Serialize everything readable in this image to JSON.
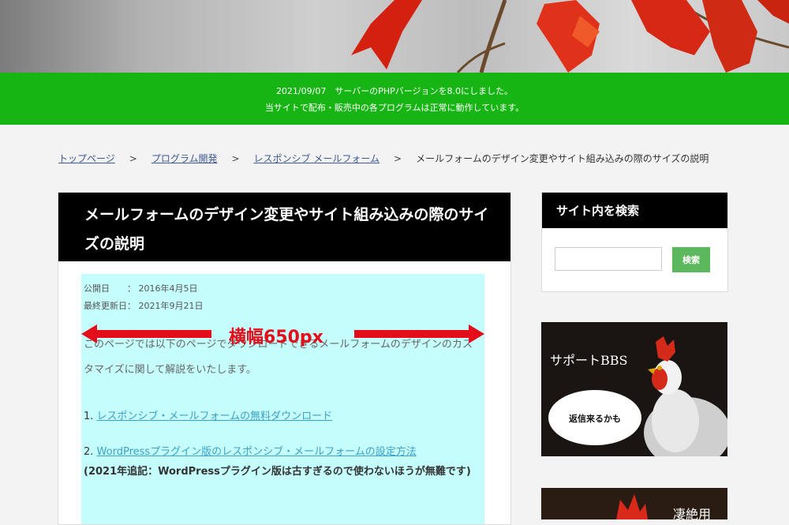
{
  "notice": {
    "line1": "2021/09/07　サーバーのPHPバージョンを8.0にしました。",
    "line2": "当サイトで配布・販売中の各プログラムは正常に動作しています。"
  },
  "breadcrumb": {
    "home": "トップページ",
    "category": "プログラム開発",
    "subcategory": "レスポンシブ メールフォーム",
    "current": "メールフォームのデザイン変更やサイト組み込みの際のサイズの説明",
    "separator": ">"
  },
  "article": {
    "title": "メールフォームのデザイン変更やサイト組み込みの際のサイズの説明",
    "published": "公開日　　：  2016年4月5日",
    "updated": "最終更新日：  2021年9月21日",
    "width_annotation": "横幅650px",
    "intro": "このページでは以下のページでダウンロードできるメールフォームのデザインのカスタマイズに関して解説をいたします。",
    "links": [
      {
        "number": "1.",
        "text": "レスポンシブ・メールフォームの無料ダウンロード"
      },
      {
        "number": "2.",
        "text": "WordPressプラグイン版のレスポンシブ・メールフォームの設定方法"
      }
    ],
    "note": "(2021年追記：WordPressプラグイン版は古すぎるので使わないほうが無難です)"
  },
  "sidebar": {
    "search_title": "サイト内を検索",
    "search_value": "",
    "search_button": "検索",
    "bbs_title": "サポートBBS",
    "bbs_bubble": "返信来るかも",
    "banner2_title": "凄絶用"
  },
  "colors": {
    "notice_bar": "#17b514",
    "annotation_red": "#e40d1a",
    "highlight_cyan": "#c5fdfd",
    "search_button": "#5cb85c"
  }
}
